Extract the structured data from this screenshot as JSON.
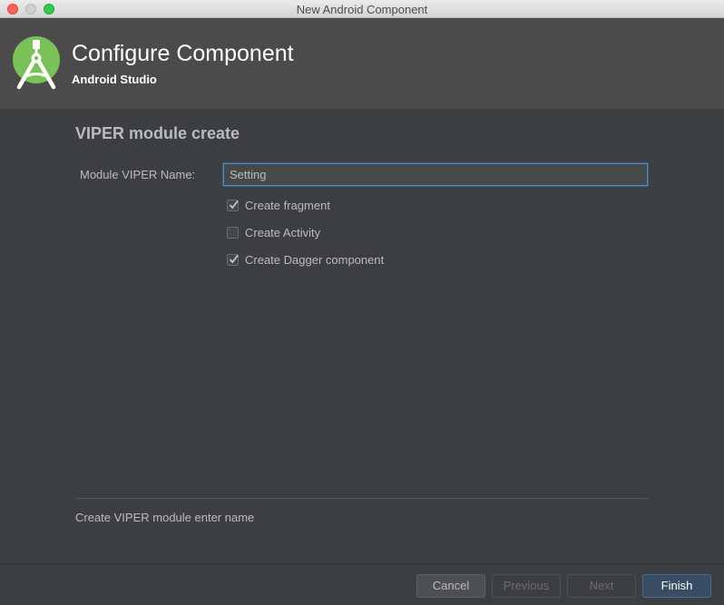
{
  "window": {
    "title": "New Android Component"
  },
  "header": {
    "title": "Configure Component",
    "subtitle": "Android Studio",
    "logo_icon": "android-studio-icon",
    "accent": "#78c257"
  },
  "form": {
    "section_title": "VIPER module create",
    "name_label": "Module VIPER Name:",
    "name_value": "Setting",
    "checkboxes": [
      {
        "label": "Create fragment",
        "checked": true
      },
      {
        "label": "Create Activity",
        "checked": false
      },
      {
        "label": "Create Dagger component",
        "checked": true
      }
    ]
  },
  "status": {
    "text": "Create VIPER module enter name"
  },
  "buttons": {
    "cancel": "Cancel",
    "previous": "Previous",
    "next": "Next",
    "finish": "Finish"
  },
  "colors": {
    "background": "#3c3f41",
    "header": "#4b4b4b",
    "focus_border": "#4a88c7",
    "finish_button": "#384c63"
  }
}
